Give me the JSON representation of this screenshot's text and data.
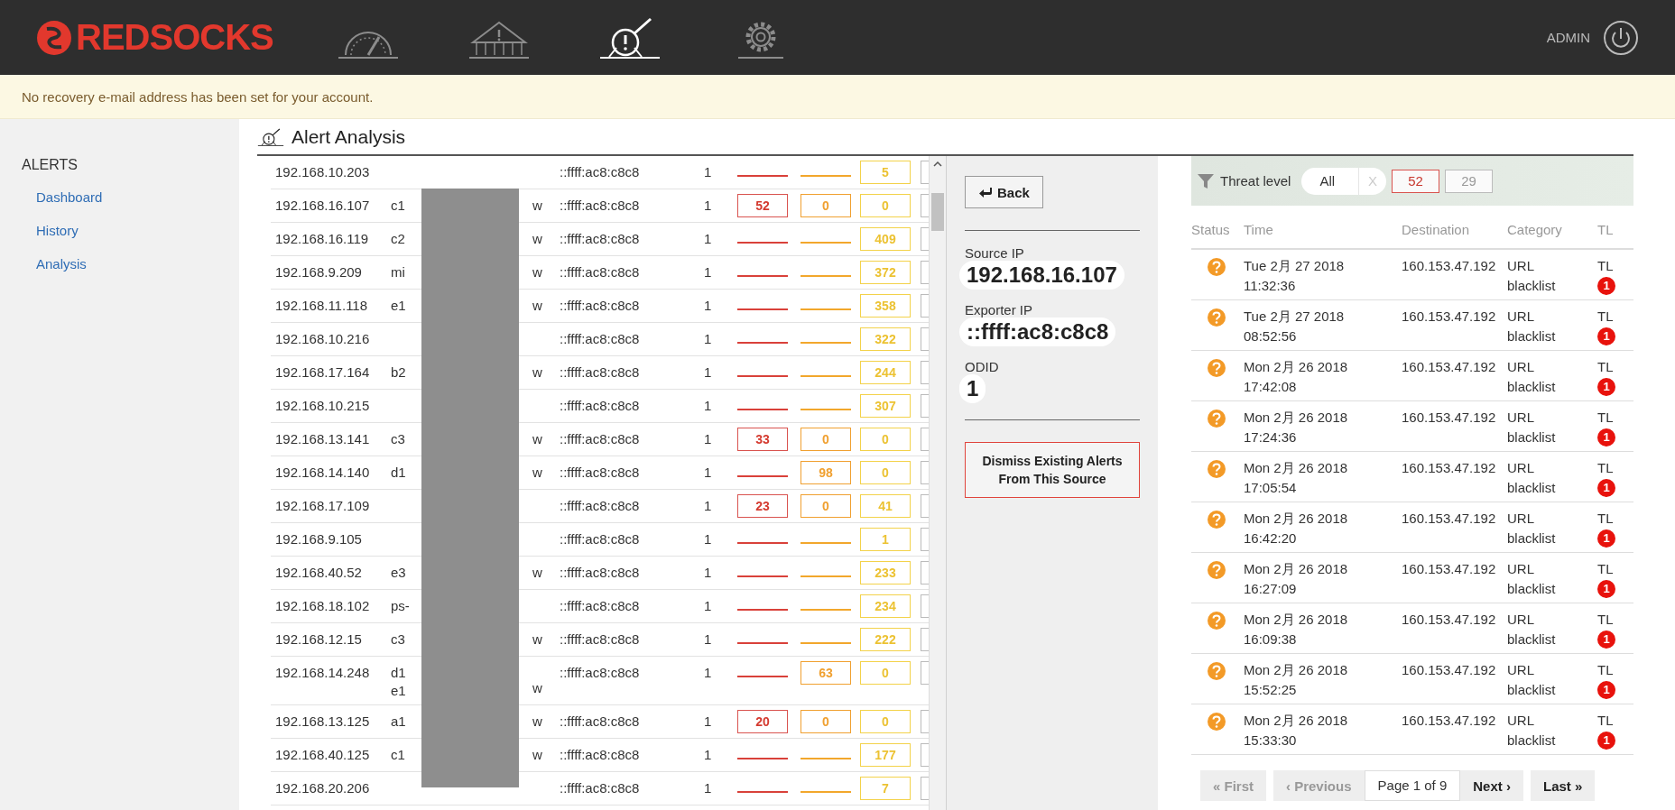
{
  "header": {
    "logo": "REDSOCKS",
    "nav": [
      {
        "kind": "gauge",
        "selected": false
      },
      {
        "kind": "tent",
        "selected": false
      },
      {
        "kind": "analysis",
        "selected": true
      },
      {
        "kind": "settings",
        "selected": false
      }
    ],
    "user": "ADMIN"
  },
  "notice": "No recovery e-mail address has been set for your account.",
  "sidebar": {
    "heading": "ALERTS",
    "items": [
      {
        "label": "Dashboard"
      },
      {
        "label": "History"
      },
      {
        "label": "Analysis"
      }
    ]
  },
  "page_title": "Alert Analysis",
  "sources": [
    {
      "ip": "192.168.10.203",
      "exporter": "::ffff:ac8:c8c8",
      "odid": "1",
      "low": "5"
    },
    {
      "ip": "192.168.16.107",
      "host": "c1",
      "host_end": "w",
      "exporter": "::ffff:ac8:c8c8",
      "odid": "1",
      "high": "52",
      "medium": "0",
      "low": "0"
    },
    {
      "ip": "192.168.16.119",
      "host": "c2",
      "host_end": "w",
      "exporter": "::ffff:ac8:c8c8",
      "odid": "1",
      "low": "409"
    },
    {
      "ip": "192.168.9.209",
      "host": "mi",
      "host_end": "w",
      "exporter": "::ffff:ac8:c8c8",
      "odid": "1",
      "low": "372"
    },
    {
      "ip": "192.168.11.118",
      "host": "e1",
      "host_end": "w",
      "exporter": "::ffff:ac8:c8c8",
      "odid": "1",
      "low": "358"
    },
    {
      "ip": "192.168.10.216",
      "exporter": "::ffff:ac8:c8c8",
      "odid": "1",
      "low": "322"
    },
    {
      "ip": "192.168.17.164",
      "host": "b2",
      "host_end": "w",
      "exporter": "::ffff:ac8:c8c8",
      "odid": "1",
      "low": "244"
    },
    {
      "ip": "192.168.10.215",
      "exporter": "::ffff:ac8:c8c8",
      "odid": "1",
      "low": "307"
    },
    {
      "ip": "192.168.13.141",
      "host": "c3",
      "host_end": "w",
      "exporter": "::ffff:ac8:c8c8",
      "odid": "1",
      "high": "33",
      "medium": "0",
      "low": "0"
    },
    {
      "ip": "192.168.14.140",
      "host": "d1",
      "host_end": "w",
      "exporter": "::ffff:ac8:c8c8",
      "odid": "1",
      "medium": "98",
      "low": "0"
    },
    {
      "ip": "192.168.17.109",
      "exporter": "::ffff:ac8:c8c8",
      "odid": "1",
      "high": "23",
      "medium": "0",
      "low": "41"
    },
    {
      "ip": "192.168.9.105",
      "exporter": "::ffff:ac8:c8c8",
      "odid": "1",
      "low": "1"
    },
    {
      "ip": "192.168.40.52",
      "host": "e3",
      "host_end": "w",
      "exporter": "::ffff:ac8:c8c8",
      "odid": "1",
      "low": "233"
    },
    {
      "ip": "192.168.18.102",
      "host": "ps-",
      "exporter": "::ffff:ac8:c8c8",
      "odid": "1",
      "low": "234"
    },
    {
      "ip": "192.168.12.15",
      "host": "c3",
      "host_end": "w",
      "exporter": "::ffff:ac8:c8c8",
      "odid": "1",
      "low": "222"
    },
    {
      "ip": "192.168.14.248",
      "host": "d1 e1",
      "host_end": "w",
      "exporter": "::ffff:ac8:c8c8",
      "odid": "1",
      "medium": "63",
      "low": "0"
    },
    {
      "ip": "192.168.13.125",
      "host": "a1",
      "host_end": "w",
      "exporter": "::ffff:ac8:c8c8",
      "odid": "1",
      "high": "20",
      "medium": "0",
      "low": "0"
    },
    {
      "ip": "192.168.40.125",
      "host": "c1",
      "host_end": "w",
      "exporter": "::ffff:ac8:c8c8",
      "odid": "1",
      "low": "177"
    },
    {
      "ip": "192.168.20.206",
      "exporter": "::ffff:ac8:c8c8",
      "odid": "1",
      "low": "7"
    }
  ],
  "detail": {
    "back": "Back",
    "fields": [
      {
        "label": "Source IP",
        "value": "192.168.16.107"
      },
      {
        "label": "Exporter IP",
        "value": "::ffff:ac8:c8c8"
      },
      {
        "label": "ODID",
        "value": "1"
      }
    ],
    "dismiss": "Dismiss Existing Alerts From This Source"
  },
  "events": {
    "filter": {
      "label": "Threat level",
      "value": "All",
      "clear": "X",
      "levels": [
        {
          "kind": "high",
          "label": "52"
        },
        {
          "kind": "medium",
          "label": "29"
        }
      ]
    },
    "columns": [
      "Status",
      "Time",
      "Destination",
      "Category",
      "TL"
    ],
    "rows": [
      {
        "time": "Tue 2月 27 2018 11:32:36",
        "destination": "160.153.47.192",
        "category": "URL blacklist",
        "tl": "TL",
        "level": "1"
      },
      {
        "time": "Tue 2月 27 2018 08:52:56",
        "destination": "160.153.47.192",
        "category": "URL blacklist",
        "tl": "TL",
        "level": "1"
      },
      {
        "time": "Mon 2月 26 2018 17:42:08",
        "destination": "160.153.47.192",
        "category": "URL blacklist",
        "tl": "TL",
        "level": "1"
      },
      {
        "time": "Mon 2月 26 2018 17:24:36",
        "destination": "160.153.47.192",
        "category": "URL blacklist",
        "tl": "TL",
        "level": "1"
      },
      {
        "time": "Mon 2月 26 2018 17:05:54",
        "destination": "160.153.47.192",
        "category": "URL blacklist",
        "tl": "TL",
        "level": "1"
      },
      {
        "time": "Mon 2月 26 2018 16:42:20",
        "destination": "160.153.47.192",
        "category": "URL blacklist",
        "tl": "TL",
        "level": "1"
      },
      {
        "time": "Mon 2月 26 2018 16:27:09",
        "destination": "160.153.47.192",
        "category": "URL blacklist",
        "tl": "TL",
        "level": "1"
      },
      {
        "time": "Mon 2月 26 2018 16:09:38",
        "destination": "160.153.47.192",
        "category": "URL blacklist",
        "tl": "TL",
        "level": "1"
      },
      {
        "time": "Mon 2月 26 2018 15:52:25",
        "destination": "160.153.47.192",
        "category": "URL blacklist",
        "tl": "TL",
        "level": "1"
      },
      {
        "time": "Mon 2月 26 2018 15:33:30",
        "destination": "160.153.47.192",
        "category": "URL blacklist",
        "tl": "TL",
        "level": "1"
      }
    ],
    "pager": [
      {
        "kind": "button",
        "label": "« First",
        "disabled": true
      },
      {
        "kind": "button",
        "label": "‹ Previous",
        "disabled": true
      },
      {
        "kind": "info",
        "label": "Page 1 of 9"
      },
      {
        "kind": "button",
        "label": "Next ›",
        "disabled": false
      },
      {
        "kind": "button",
        "label": "Last »",
        "disabled": false
      }
    ]
  }
}
